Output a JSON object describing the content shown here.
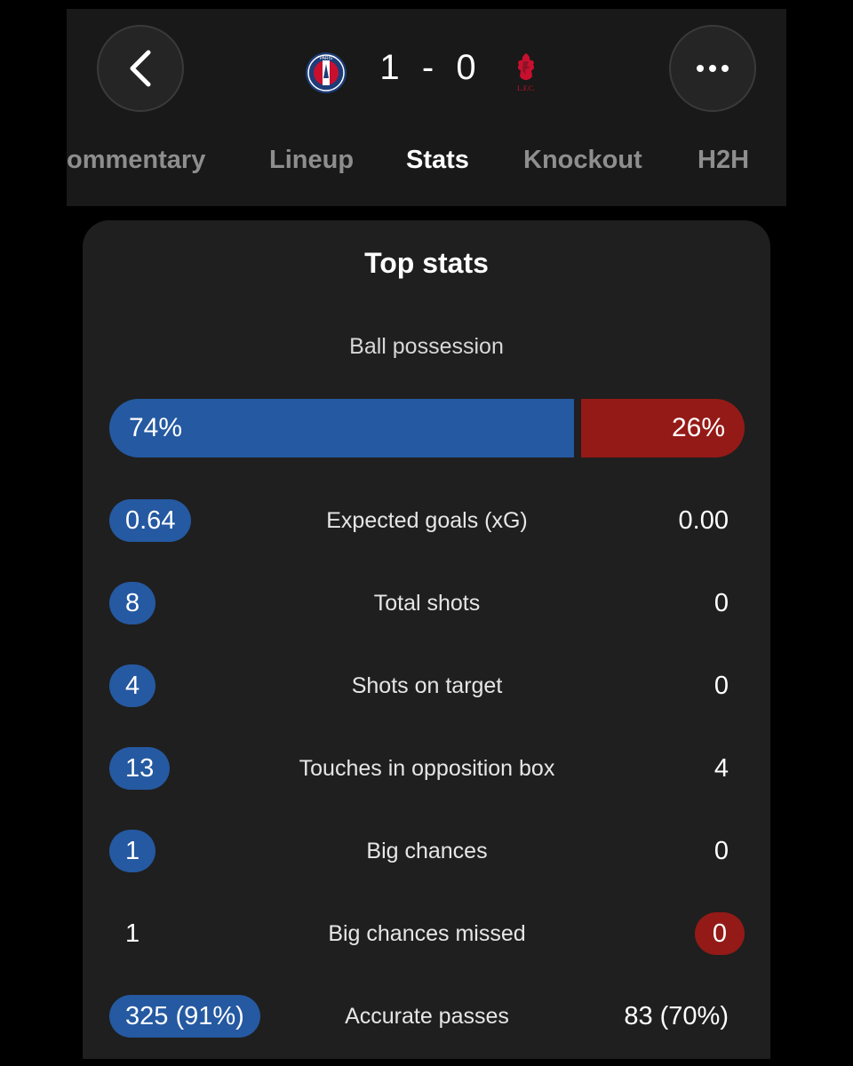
{
  "header": {
    "home_crest": "psg-crest",
    "away_crest": "lfc-crest",
    "home_crest_text": "PARIS",
    "away_crest_text": "L.F.C.",
    "score": "1  -  0"
  },
  "tabs": [
    {
      "label": "ommentary",
      "active": false
    },
    {
      "label": "Lineup",
      "active": false
    },
    {
      "label": "Stats",
      "active": true
    },
    {
      "label": "Knockout",
      "active": false
    },
    {
      "label": "H2H",
      "active": false
    }
  ],
  "top_stats": {
    "title": "Top stats",
    "possession": {
      "label": "Ball possession",
      "home": "74%",
      "away": "26%",
      "home_fraction": 0.74
    },
    "rows": [
      {
        "label": "Expected goals (xG)",
        "home": "0.64",
        "away": "0.00",
        "highlight": "home"
      },
      {
        "label": "Total shots",
        "home": "8",
        "away": "0",
        "highlight": "home"
      },
      {
        "label": "Shots on target",
        "home": "4",
        "away": "0",
        "highlight": "home"
      },
      {
        "label": "Touches in opposition box",
        "home": "13",
        "away": "4",
        "highlight": "home"
      },
      {
        "label": "Big chances",
        "home": "1",
        "away": "0",
        "highlight": "home"
      },
      {
        "label": "Big chances missed",
        "home": "1",
        "away": "0",
        "highlight": "away"
      },
      {
        "label": "Accurate passes",
        "home": "325 (91%)",
        "away": "83 (70%)",
        "highlight": "home"
      }
    ]
  },
  "colors": {
    "home": "#2559a1",
    "away": "#941a17",
    "card": "#1f1f1f",
    "header": "#191919"
  }
}
